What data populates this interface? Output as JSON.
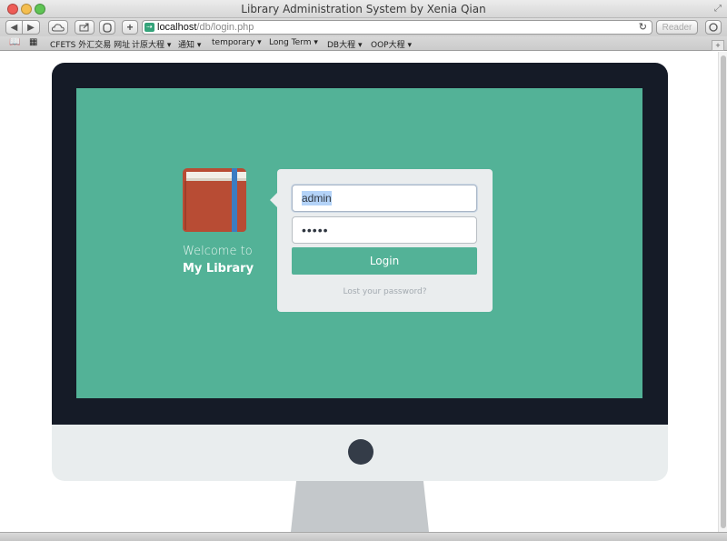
{
  "window": {
    "title": "Library Administration System by Xenia Qian"
  },
  "toolbar": {
    "back_icon": "◀",
    "forward_icon": "▶",
    "new_tab_label": "+",
    "url_host": "localhost",
    "url_path": "/db/login.php",
    "reader_label": "Reader"
  },
  "bookmarks": {
    "items": [
      "CFETS 外汇交易 网址",
      "计原大程 ▾",
      "通知 ▾",
      "temporary ▾",
      "Long Term ▾",
      "DB大程 ▾",
      "OOP大程 ▾"
    ]
  },
  "login": {
    "welcome_text": "Welcome to",
    "library_name": "My Library",
    "username_value": "admin",
    "password_mask": "•••••",
    "login_label": "Login",
    "lost_password": "Lost your password?"
  },
  "colors": {
    "accent": "#53b297",
    "monitor_frame": "#151b27",
    "book_cover": "#b84c34",
    "bookmark_ribbon": "#3c7cc2",
    "card_bg": "#eaedee"
  }
}
